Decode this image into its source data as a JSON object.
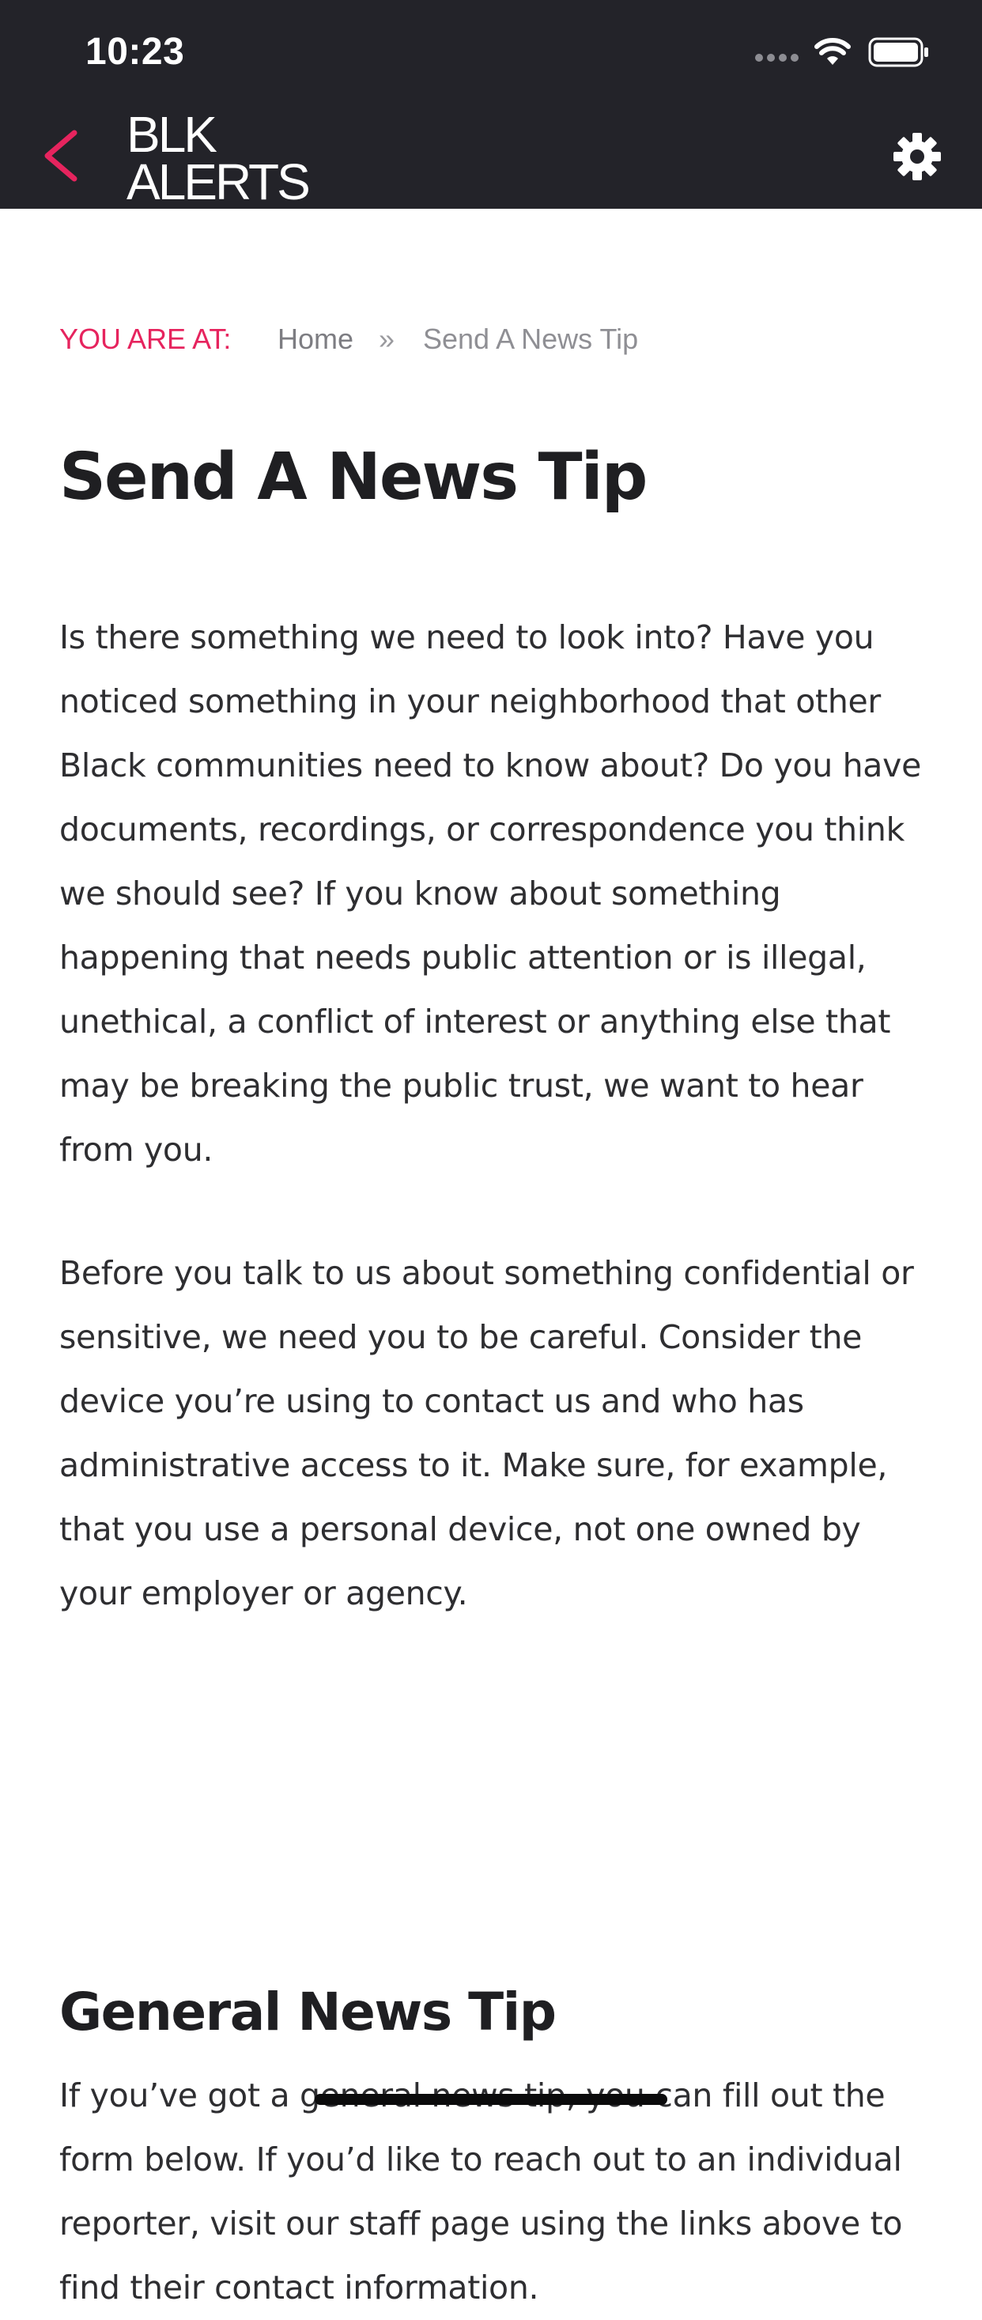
{
  "status_bar": {
    "time": "10:23"
  },
  "nav": {
    "logo_line1": "BLK",
    "logo_line2": "ALERTS"
  },
  "breadcrumb": {
    "label": "YOU ARE AT:",
    "home": "Home",
    "separator": "»",
    "current": "Send A News Tip"
  },
  "article": {
    "title": "Send A News Tip",
    "paragraph1": "Is there something we need to look into? Have you noticed something in your neighborhood that other Black communities need to know about? Do you have documents, recordings, or correspondence you think we should see? If you know about something happening that needs public attention or is illegal, unethical, a conflict of interest or anything else that may be breaking the public trust, we want to hear from you.",
    "paragraph2": "Before you talk to us about something confidential or sensitive, we need you to be careful. Consider the device you’re using to contact us and who has administrative access to it. Make sure, for example, that you use a personal device, not one owned by your employer or agency.",
    "section_heading": "General News Tip",
    "paragraph3": "If you’ve got a general news tip, you can fill out the form below. If you’d like to reach out to an individual reporter, visit our staff page using the links above to find their contact information."
  },
  "colors": {
    "header_bg": "#232329",
    "accent": "#e6245e",
    "text": "#2e2e31"
  },
  "icons": {
    "back": "chevron-left-icon",
    "settings": "gear-icon",
    "wifi": "wifi-icon",
    "battery": "battery-icon",
    "signal": "signal-icon"
  }
}
